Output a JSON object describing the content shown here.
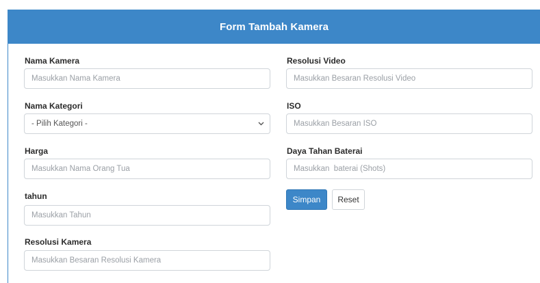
{
  "form": {
    "title": "Form Tambah Kamera",
    "left": {
      "nama_kamera": {
        "label": "Nama Kamera",
        "placeholder": "Masukkan Nama Kamera"
      },
      "nama_kategori": {
        "label": "Nama Kategori",
        "selected": "- Pilih Kategori -"
      },
      "harga": {
        "label": "Harga",
        "placeholder": "Masukkan Nama Orang Tua"
      },
      "tahun": {
        "label": "tahun",
        "placeholder": "Masukkan Tahun"
      },
      "resolusi_kamera": {
        "label": "Resolusi Kamera",
        "placeholder": "Masukkan Besaran Resolusi Kamera"
      }
    },
    "right": {
      "resolusi_video": {
        "label": "Resolusi Video",
        "placeholder": "Masukkan Besaran Resolusi Video"
      },
      "iso": {
        "label": "ISO",
        "placeholder": "Masukkan Besaran ISO"
      },
      "daya_tahan_baterai": {
        "label": "Daya Tahan Baterai",
        "placeholder": "Masukkan  baterai (Shots)"
      }
    },
    "buttons": {
      "simpan": "Simpan",
      "reset": "Reset"
    }
  },
  "colors": {
    "header": "#3d87c8",
    "primary_button": "#3d87c8",
    "border": "#cfd4d9"
  },
  "icons": {
    "select_caret": "chevron-down-icon"
  }
}
